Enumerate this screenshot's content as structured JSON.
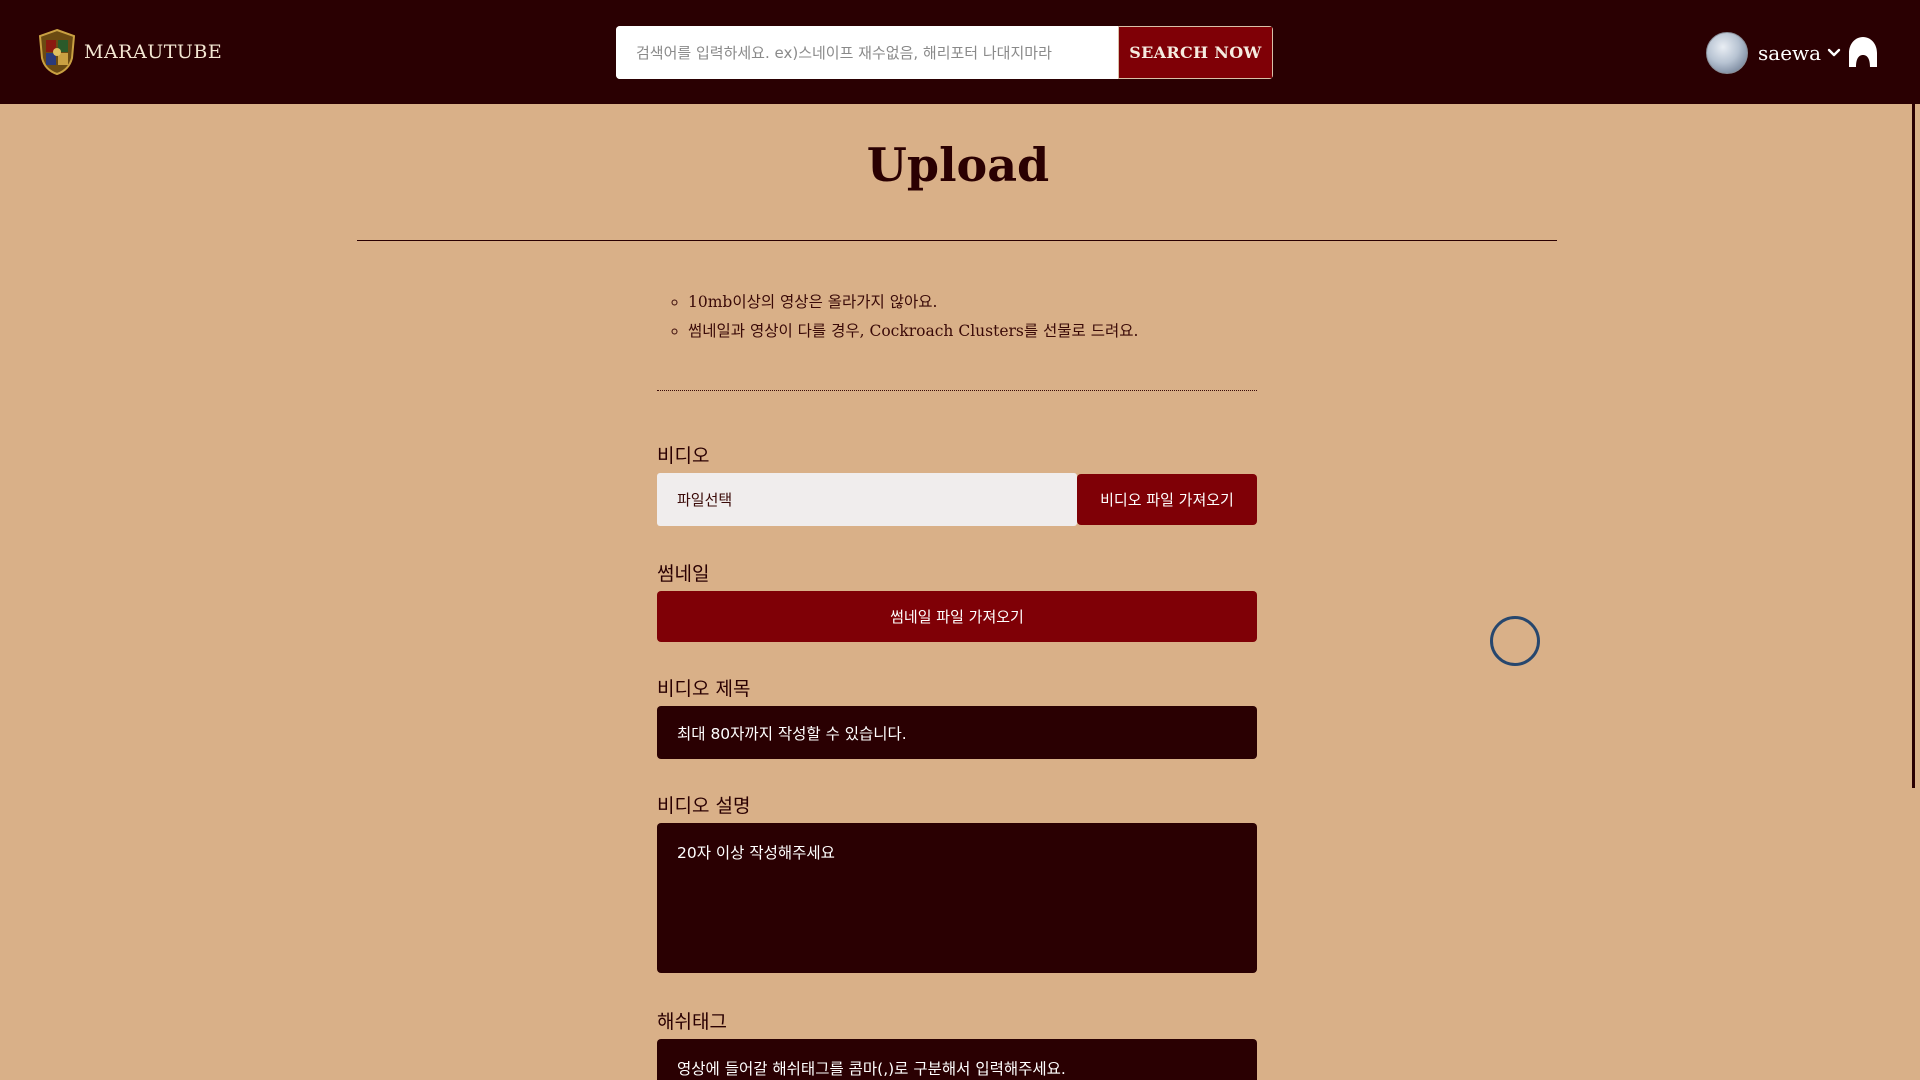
{
  "header": {
    "logo_text": "MARAUTUBE",
    "search_placeholder": "검색어를 입력하세요. ex)스네이프 재수없음, 해리포터 나대지마라",
    "search_button": "SEARCH NOW",
    "username": "saewa"
  },
  "page": {
    "title": "Upload"
  },
  "notice": [
    "10mb이상의 영상은 올라가지 않아요.",
    "썸네일과 영상이 다를 경우, Cockroach Clusters를 선물로 드려요."
  ],
  "form": {
    "video_label": "비디오",
    "video_file_placeholder": "파일선택",
    "video_file_button": "비디오 파일 가져오기",
    "thumbnail_label": "썸네일",
    "thumbnail_button": "썸네일 파일 가져오기",
    "title_label": "비디오 제목",
    "title_placeholder": "최대 80자까지 작성할 수 있습니다.",
    "description_label": "비디오 설명",
    "description_placeholder": "20자 이상 작성해주세요",
    "hashtag_label": "해쉬태그",
    "hashtag_placeholder": "영상에 들어갈 해쉬태그를 콤마(,)로 구분해서 입력해주세요."
  },
  "colors": {
    "background": "#d9b088",
    "header": "#2a0002",
    "accent": "#7f0006",
    "input_light": "#f0eded"
  },
  "icons": [
    "hogwarts-crest-icon",
    "chevron-down-icon",
    "profile-icon"
  ]
}
